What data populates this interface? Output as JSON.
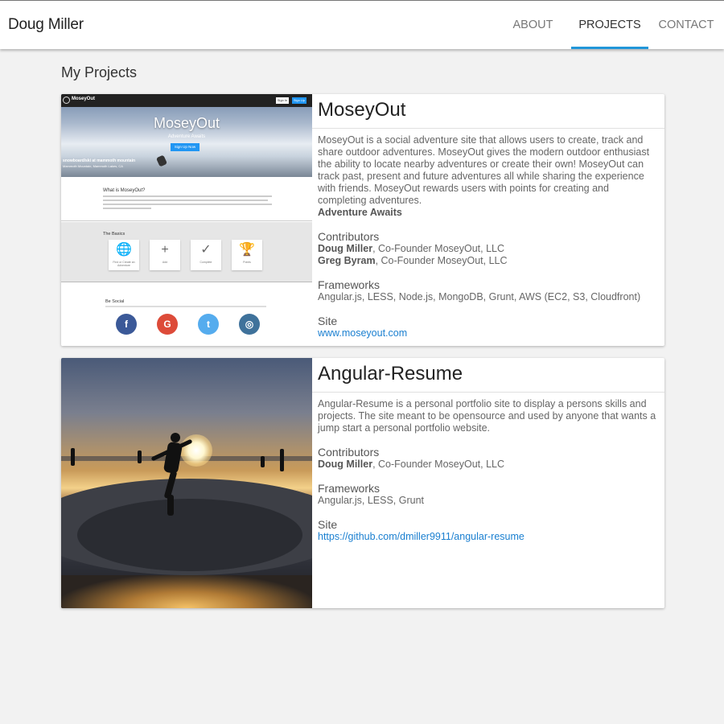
{
  "header": {
    "brand": "Doug Miller",
    "nav": {
      "about": "ABOUT",
      "projects": "PROJECTS",
      "contact": "CONTACT"
    },
    "active_tab": "PROJECTS",
    "accent_color": "#2196d9"
  },
  "section_title": "My Projects",
  "projects": [
    {
      "title": "MoseyOut",
      "description": "MoseyOut is a social adventure site that allows users to create, track and share outdoor adventures. MoseyOut gives the modern outdoor enthusiast the ability to locate nearby adventures or create their own! MoseyOut can track past, present and future adventures all while sharing the experience with friends. MoseyOut rewards users with points for creating and completing adventures.",
      "tagline": "Adventure Awaits",
      "contributors_label": "Contributors",
      "contributors": [
        {
          "name": "Doug Miller",
          "role": ", Co-Founder MoseyOut, LLC"
        },
        {
          "name": "Greg Byram",
          "role": ", Co-Founder MoseyOut, LLC"
        }
      ],
      "frameworks_label": "Frameworks",
      "frameworks": "Angular.js, LESS, Node.js, MongoDB, Grunt, AWS (EC2, S3, Cloudfront)",
      "site_label": "Site",
      "site_link": "www.moseyout.com",
      "preview": {
        "app_name": "MoseyOut",
        "sign_in": "Sign In",
        "sign_up": "Sign Up",
        "hero_title": "MoseyOut",
        "hero_subtitle": "Adventure Awaits",
        "hero_button": "Sign Up Now",
        "location": "snowboard/ski at mammoth mountain",
        "location_sub": "Mammoth Mountain, Mammoth Lakes, CA",
        "what_title": "What is MoseyOut?",
        "basics_title": "The Basics",
        "basics": [
          {
            "icon": "globe-icon",
            "glyph": "🌐",
            "label": "Find or Create an Adventure"
          },
          {
            "icon": "plus-icon",
            "glyph": "+",
            "label": "Add"
          },
          {
            "icon": "check-icon",
            "glyph": "✓",
            "label": "Complete"
          },
          {
            "icon": "trophy-icon",
            "glyph": "🏆",
            "label": "Points"
          }
        ],
        "social_title": "Be Social",
        "social": [
          {
            "icon": "facebook-icon",
            "glyph": "f",
            "color": "#3b5998"
          },
          {
            "icon": "google-icon",
            "glyph": "G",
            "color": "#dd4b39"
          },
          {
            "icon": "twitter-icon",
            "glyph": "t",
            "color": "#55acee"
          },
          {
            "icon": "instagram-icon",
            "glyph": "◎",
            "color": "#3f729b"
          }
        ]
      }
    },
    {
      "title": "Angular-Resume",
      "description": "Angular-Resume is a personal portfolio site to display a persons skills and projects. The site meant to be opensource and used by anyone that wants a jump start a personal portfolio website.",
      "contributors_label": "Contributors",
      "contributors": [
        {
          "name": "Doug Miller",
          "role": ", Co-Founder MoseyOut, LLC"
        }
      ],
      "frameworks_label": "Frameworks",
      "frameworks": "Angular.js, LESS, Grunt",
      "site_label": "Site",
      "site_link": "https://github.com/dmiller9911/angular-resume"
    }
  ]
}
